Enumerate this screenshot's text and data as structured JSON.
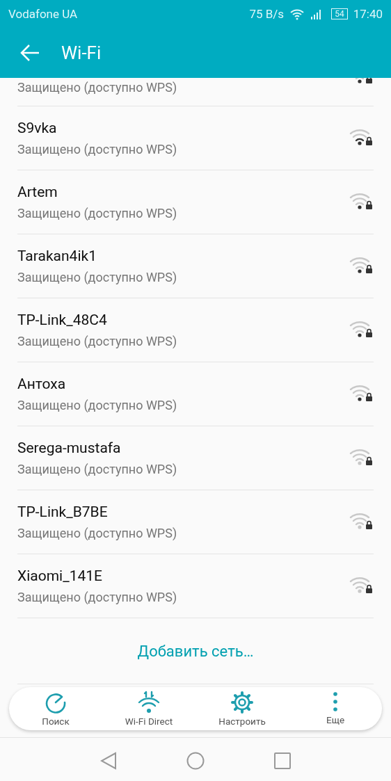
{
  "status_bar": {
    "carrier": "Vodafone UA",
    "speed": "75 B/s",
    "battery": "54",
    "time": "17:40"
  },
  "app_bar": {
    "title": "Wi-Fi"
  },
  "networks": [
    {
      "status": "Защищено (доступно WPS)",
      "kind": "fair",
      "cut": true
    },
    {
      "name": "S9vka",
      "status": "Защищено (доступно WPS)",
      "kind": "good"
    },
    {
      "name": "Artem",
      "status": "Защищено (доступно WPS)",
      "kind": "fair"
    },
    {
      "name": "Tarakan4ik1",
      "status": "Защищено (доступно WPS)",
      "kind": "fair"
    },
    {
      "name": "TP-Link_48C4",
      "status": "Защищено (доступно WPS)",
      "kind": "fair"
    },
    {
      "name": "Антоха",
      "status": "Защищено (доступно WPS)",
      "kind": "fair"
    },
    {
      "name": "Serega-mustafa",
      "status": "Защищено (доступно WPS)",
      "kind": "weak"
    },
    {
      "name": "TP-Link_B7BE",
      "status": "Защищено (доступно WPS)",
      "kind": "weak"
    },
    {
      "name": "Xiaomi_141E",
      "status": "Защищено (доступно WPS)",
      "kind": "weak"
    }
  ],
  "add_network": "Добавить сеть…",
  "bottom_actions": [
    {
      "label": "Поиск",
      "kind": "refresh"
    },
    {
      "label": "Wi-Fi Direct",
      "kind": "direct"
    },
    {
      "label": "Настроить",
      "kind": "settings"
    },
    {
      "label": "Еще",
      "kind": "more"
    }
  ]
}
